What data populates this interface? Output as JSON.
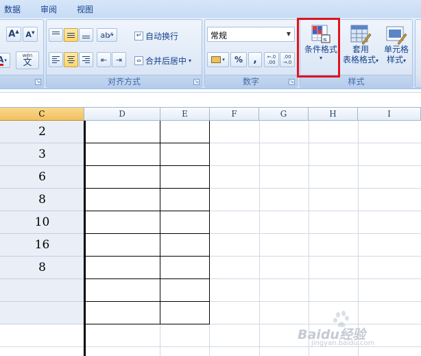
{
  "menu": {
    "tabs": [
      "数据",
      "审阅",
      "视图"
    ]
  },
  "font_group": {
    "grow_icon": "A-up-icon",
    "shrink_icon": "A-down-icon",
    "phonetic_top": "wén",
    "phonetic_char": "文"
  },
  "alignment_group": {
    "title": "对齐方式",
    "wrap_label": "自动换行",
    "merge_label": "合并后居中"
  },
  "number_group": {
    "title": "数字",
    "format_value": "常规",
    "percent": "%",
    "comma": ",",
    "increase_decimal_top": "←.0",
    "increase_decimal_bottom": ".00",
    "decrease_decimal_top": ".00",
    "decrease_decimal_bottom": "→.0"
  },
  "styles_group": {
    "title": "样式",
    "conditional_label": "条件格式",
    "table_label_1": "套用",
    "table_label_2": "表格格式",
    "cell_label_1": "单元格",
    "cell_label_2": "样式"
  },
  "colors": {
    "highlight_border": "#e0121b",
    "selected_column": "#f1c15f",
    "column_c_fill": "#e9eef7"
  },
  "columns": [
    "C",
    "D",
    "E",
    "F",
    "G",
    "H",
    "I"
  ],
  "column_c_values": [
    "2",
    "3",
    "6",
    "8",
    "10",
    "16",
    "8",
    "",
    ""
  ],
  "watermark": {
    "brand": "Baidu经验",
    "url": "jingyan.baidu.com"
  }
}
